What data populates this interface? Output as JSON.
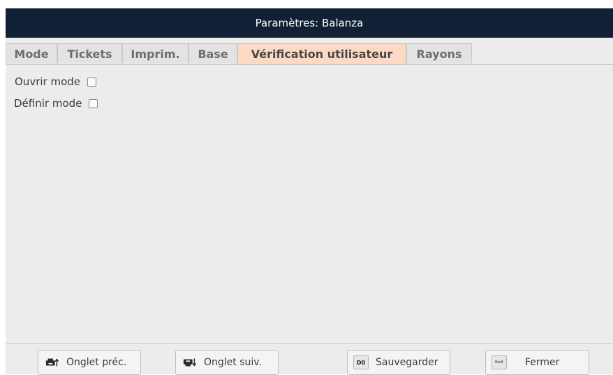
{
  "window": {
    "title": "Paramètres: Balanza"
  },
  "tabs": [
    {
      "label": "Mode",
      "active": false
    },
    {
      "label": "Tickets",
      "active": false
    },
    {
      "label": "Imprim.",
      "active": false
    },
    {
      "label": "Base",
      "active": false
    },
    {
      "label": "Vérification utilisateur",
      "active": true
    },
    {
      "label": "Rayons",
      "active": false
    }
  ],
  "panel": {
    "options": [
      {
        "label": "Ouvrir mode",
        "checked": false
      },
      {
        "label": "Définir mode",
        "checked": false
      }
    ]
  },
  "buttons": {
    "prev_tab": {
      "label": "Onglet préc.",
      "icon": "printer-up-icon"
    },
    "next_tab": {
      "label": "Onglet suiv.",
      "icon": "printer-down-icon"
    },
    "save": {
      "label": "Sauvegarder",
      "key": "D0"
    },
    "close": {
      "label": "Fermer",
      "key": "EscK"
    }
  },
  "colors": {
    "titlebar": "#112034",
    "active_tab": "#fbd9c4",
    "background": "#ececec"
  }
}
